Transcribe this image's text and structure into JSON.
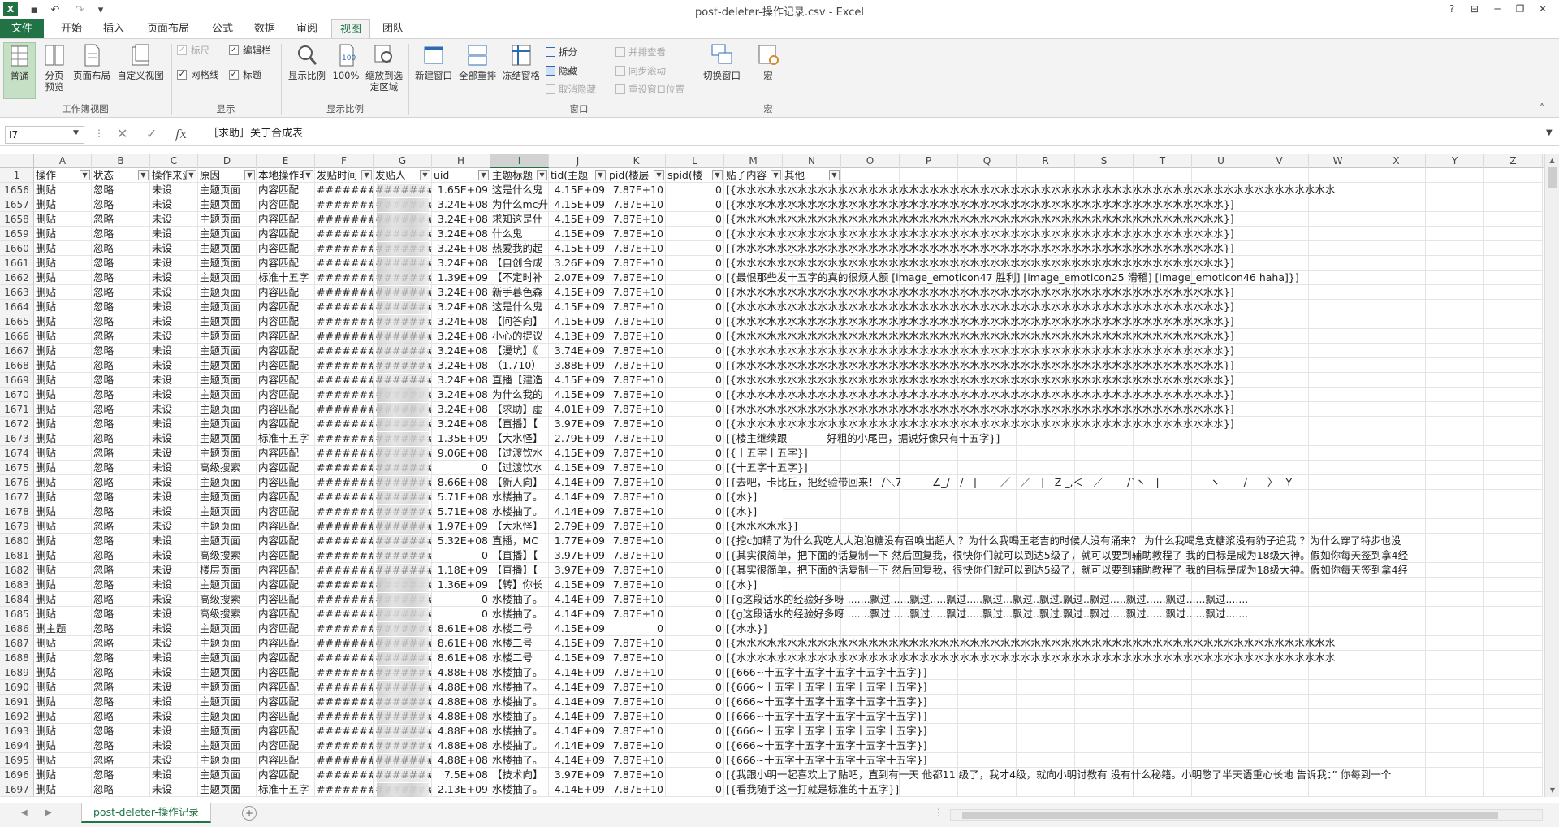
{
  "window": {
    "title": "post-deleter-操作记录.csv - Excel"
  },
  "tabs": [
    "文件",
    "开始",
    "插入",
    "页面布局",
    "公式",
    "数据",
    "审阅",
    "视图",
    "团队"
  ],
  "ribbon": {
    "workbook_views": {
      "group": "工作簿视图",
      "normal": "普通",
      "page_break": "分页预览",
      "page_layout": "页面布局",
      "custom": "自定义视图"
    },
    "show": {
      "group": "显示",
      "ruler": "标尺",
      "edit_bar": "编辑栏",
      "gridlines": "网格线",
      "headings": "标题"
    },
    "zoom": {
      "group": "显示比例",
      "zoom": "显示比例",
      "hundred": "100%",
      "to_selection": "缩放到选定区域"
    },
    "window": {
      "group": "窗口",
      "new_window": "新建窗口",
      "arrange_all": "全部重排",
      "freeze": "冻结窗格",
      "split": "拆分",
      "hide": "隐藏",
      "unhide": "取消隐藏",
      "side_by_side": "并排查看",
      "sync_scroll": "同步滚动",
      "reset_pos": "重设窗口位置",
      "switch": "切换窗口"
    },
    "macros": {
      "group": "宏",
      "macros": "宏"
    }
  },
  "formula_bar": {
    "name_box": "I7",
    "fx": "fx",
    "value": "［求助］关于合成表"
  },
  "columns": [
    "A",
    "B",
    "C",
    "D",
    "E",
    "F",
    "G",
    "H",
    "I",
    "J",
    "K",
    "L",
    "M",
    "N",
    "O",
    "P",
    "Q",
    "R",
    "S",
    "T",
    "U",
    "V",
    "W",
    "X",
    "Y",
    "Z"
  ],
  "header_row": {
    "row": "1",
    "cells": [
      "操作",
      "状态",
      "操作来源",
      "原因",
      "本地操作时",
      "发贴时间",
      "发贴人",
      "uid",
      "主题标题",
      "tid(主题",
      "pid(楼层",
      "spid(楼",
      "贴子内容",
      "其他"
    ]
  },
  "rows": [
    [
      "1656",
      "删贴",
      "忽略",
      "未设",
      "主题页面",
      "内容匹配",
      "########",
      "########",
      "1.65E+09",
      "这是什么鬼",
      "4.15E+09",
      "7.87E+10",
      "0",
      "[{水水水水水水水水水水水水水水水水水水水水水水水水水水水水水水水水水水水水水水水水水水水水水水水水水水水水水水水水水水水"
    ],
    [
      "1657",
      "删贴",
      "忽略",
      "未设",
      "主题页面",
      "内容匹配",
      "########",
      "########",
      "3.24E+08",
      "为什么mc升",
      "4.15E+09",
      "7.87E+10",
      "0",
      "[{水水水水水水水水水水水水水水水水水水水水水水水水水水水水水水水水水水水水水水水水水水水水水水水水}]"
    ],
    [
      "1658",
      "删贴",
      "忽略",
      "未设",
      "主题页面",
      "内容匹配",
      "########",
      "########",
      "3.24E+08",
      "求知这是什",
      "4.15E+09",
      "7.87E+10",
      "0",
      "[{水水水水水水水水水水水水水水水水水水水水水水水水水水水水水水水水水水水水水水水水水水水水水水水水}]"
    ],
    [
      "1659",
      "删贴",
      "忽略",
      "未设",
      "主题页面",
      "内容匹配",
      "########",
      "########",
      "3.24E+08",
      "什么鬼",
      "4.15E+09",
      "7.87E+10",
      "0",
      "[{水水水水水水水水水水水水水水水水水水水水水水水水水水水水水水水水水水水水水水水水水水水水水水水水}]"
    ],
    [
      "1660",
      "删贴",
      "忽略",
      "未设",
      "主题页面",
      "内容匹配",
      "########",
      "########",
      "3.24E+08",
      "热爱我的起",
      "4.15E+09",
      "7.87E+10",
      "0",
      "[{水水水水水水水水水水水水水水水水水水水水水水水水水水水水水水水水水水水水水水水水水水水水水水水水}]"
    ],
    [
      "1661",
      "删贴",
      "忽略",
      "未设",
      "主题页面",
      "内容匹配",
      "########",
      "########",
      "3.24E+08",
      "【自创合成",
      "3.26E+09",
      "7.87E+10",
      "0",
      "[{水水水水水水水水水水水水水水水水水水水水水水水水水水水水水水水水水水水水水水水水水水水水水水水水}]"
    ],
    [
      "1662",
      "删贴",
      "忽略",
      "未设",
      "主题页面",
      "标准十五字",
      "########",
      "########",
      "1.39E+09",
      "【不定时补",
      "2.07E+09",
      "7.87E+10",
      "0",
      "[{最恨那些发十五字的真的很烦人额 [image_emoticon47 胜利] [image_emoticon25 滑稽] [image_emoticon46 haha]}]"
    ],
    [
      "1663",
      "删贴",
      "忽略",
      "未设",
      "主题页面",
      "内容匹配",
      "########",
      "########",
      "3.24E+08",
      "新手暮色森",
      "4.15E+09",
      "7.87E+10",
      "0",
      "[{水水水水水水水水水水水水水水水水水水水水水水水水水水水水水水水水水水水水水水水水水水水水水水水水}]"
    ],
    [
      "1664",
      "删贴",
      "忽略",
      "未设",
      "主题页面",
      "内容匹配",
      "########",
      "########",
      "3.24E+08",
      "这是什么鬼",
      "4.15E+09",
      "7.87E+10",
      "0",
      "[{水水水水水水水水水水水水水水水水水水水水水水水水水水水水水水水水水水水水水水水水水水水水水水水水}]"
    ],
    [
      "1665",
      "删贴",
      "忽略",
      "未设",
      "主题页面",
      "内容匹配",
      "########",
      "########",
      "3.24E+08",
      "【问答向】",
      "4.15E+09",
      "7.87E+10",
      "0",
      "[{水水水水水水水水水水水水水水水水水水水水水水水水水水水水水水水水水水水水水水水水水水水水水水水水}]"
    ],
    [
      "1666",
      "删贴",
      "忽略",
      "未设",
      "主题页面",
      "内容匹配",
      "########",
      "########",
      "3.24E+08",
      "小心的提议",
      "4.13E+09",
      "7.87E+10",
      "0",
      "[{水水水水水水水水水水水水水水水水水水水水水水水水水水水水水水水水水水水水水水水水水水水水水水水水}]"
    ],
    [
      "1667",
      "删贴",
      "忽略",
      "未设",
      "主题页面",
      "内容匹配",
      "########",
      "########",
      "3.24E+08",
      "【漫坑】《",
      "3.74E+09",
      "7.87E+10",
      "0",
      "[{水水水水水水水水水水水水水水水水水水水水水水水水水水水水水水水水水水水水水水水水水水水水水水水水}]"
    ],
    [
      "1668",
      "删贴",
      "忽略",
      "未设",
      "主题页面",
      "内容匹配",
      "########",
      "########",
      "3.24E+08",
      "（1.710）",
      "3.88E+09",
      "7.87E+10",
      "0",
      "[{水水水水水水水水水水水水水水水水水水水水水水水水水水水水水水水水水水水水水水水水水水水水水水水水}]"
    ],
    [
      "1669",
      "删贴",
      "忽略",
      "未设",
      "主题页面",
      "内容匹配",
      "########",
      "########",
      "3.24E+08",
      "直播【建造",
      "4.15E+09",
      "7.87E+10",
      "0",
      "[{水水水水水水水水水水水水水水水水水水水水水水水水水水水水水水水水水水水水水水水水水水水水水水水水}]"
    ],
    [
      "1670",
      "删贴",
      "忽略",
      "未设",
      "主题页面",
      "内容匹配",
      "########",
      "########",
      "3.24E+08",
      "为什么我的",
      "4.15E+09",
      "7.87E+10",
      "0",
      "[{水水水水水水水水水水水水水水水水水水水水水水水水水水水水水水水水水水水水水水水水水水水水水水水水}]"
    ],
    [
      "1671",
      "删贴",
      "忽略",
      "未设",
      "主题页面",
      "内容匹配",
      "########",
      "########",
      "3.24E+08",
      "【求助】虚",
      "4.01E+09",
      "7.87E+10",
      "0",
      "[{水水水水水水水水水水水水水水水水水水水水水水水水水水水水水水水水水水水水水水水水水水水水水水水水}]"
    ],
    [
      "1672",
      "删贴",
      "忽略",
      "未设",
      "主题页面",
      "内容匹配",
      "########",
      "########",
      "3.24E+08",
      "【直播】【",
      "3.97E+09",
      "7.87E+10",
      "0",
      "[{水水水水水水水水水水水水水水水水水水水水水水水水水水水水水水水水水水水水水水水水水水水水水水水水}]"
    ],
    [
      "1673",
      "删贴",
      "忽略",
      "未设",
      "主题页面",
      "标准十五字",
      "########",
      "########",
      "1.35E+09",
      "【大水怪】",
      "2.79E+09",
      "7.87E+10",
      "0",
      "[{楼主继续跟 ----------好粗的小尾巴，据说好像只有十五字}]"
    ],
    [
      "1674",
      "删贴",
      "忽略",
      "未设",
      "主题页面",
      "内容匹配",
      "########",
      "########",
      "9.06E+08",
      "【过渡饮水",
      "4.15E+09",
      "7.87E+10",
      "0",
      "[{十五字十五字}]"
    ],
    [
      "1675",
      "删贴",
      "忽略",
      "未设",
      "高级搜索",
      "内容匹配",
      "########",
      "########",
      "0",
      "【过渡饮水",
      "4.15E+09",
      "7.87E+10",
      "0",
      "[{十五字十五字}]"
    ],
    [
      "1676",
      "删贴",
      "忽略",
      "未设",
      "主题页面",
      "内容匹配",
      "########",
      "########",
      "8.66E+08",
      "【新人向】",
      "4.14E+09",
      "7.87E+10",
      "0",
      "[{去吧，卡比丘，把经验带回来！ /＼7　　　∠_/　/　|　　 ／　／　|　Z _,＜　／　　 /`ヽ　|　　　　　ヽ　　 /　　〉　 Y"
    ],
    [
      "1677",
      "删贴",
      "忽略",
      "未设",
      "主题页面",
      "内容匹配",
      "########",
      "########",
      "5.71E+08",
      "水楼抽了。",
      "4.14E+09",
      "7.87E+10",
      "0",
      "[{水}]"
    ],
    [
      "1678",
      "删贴",
      "忽略",
      "未设",
      "主题页面",
      "内容匹配",
      "########",
      "########",
      "5.71E+08",
      "水楼抽了。",
      "4.14E+09",
      "7.87E+10",
      "0",
      "[{水}]"
    ],
    [
      "1679",
      "删贴",
      "忽略",
      "未设",
      "主题页面",
      "内容匹配",
      "########",
      "########",
      "1.97E+09",
      "【大水怪】",
      "2.79E+09",
      "7.87E+10",
      "0",
      "[{水水水水水}]"
    ],
    [
      "1680",
      "删贴",
      "忽略",
      "未设",
      "主题页面",
      "内容匹配",
      "########",
      "########",
      "5.32E+08",
      "直播，MC",
      "1.77E+09",
      "7.87E+10",
      "0",
      "[{挖c加精了为什么我吃大大泡泡糖没有召唤出超人 ？为什么我喝王老吉的时候人没有涌来？ 为什么我喝急支糖浆没有豹子追我 ？为什么穿了特步也没"
    ],
    [
      "1681",
      "删贴",
      "忽略",
      "未设",
      "高级搜索",
      "内容匹配",
      "########",
      "########",
      "0",
      "【直播】【",
      "3.97E+09",
      "7.87E+10",
      "0",
      "[{其实很简单，把下面的话复制一下 然后回复我，很快你们就可以到达5级了，就可以要到辅助教程了 我的目标是成为18级大神。假如你每天签到拿4经"
    ],
    [
      "1682",
      "删贴",
      "忽略",
      "未设",
      "楼层页面",
      "内容匹配",
      "########",
      "########",
      "1.18E+09",
      "【直播】【",
      "3.97E+09",
      "7.87E+10",
      "0",
      "[{其实很简单，把下面的话复制一下 然后回复我，很快你们就可以到达5级了，就可以要到辅助教程了 我的目标是成为18级大神。假如你每天签到拿4经"
    ],
    [
      "1683",
      "删贴",
      "忽略",
      "未设",
      "主题页面",
      "内容匹配",
      "########",
      "########",
      "1.36E+09",
      "【转】你长",
      "4.15E+09",
      "7.87E+10",
      "0",
      "[{水}]"
    ],
    [
      "1684",
      "删贴",
      "忽略",
      "未设",
      "高级搜索",
      "内容匹配",
      "########",
      "########",
      "0",
      "水楼抽了。",
      "4.14E+09",
      "7.87E+10",
      "0",
      "[{g这段话水的经验好多呀 .......飘过......飘过.....飘过.....飘过...飘过..飘过.飘过..飘过.....飘过......飘过......飘过......."
    ],
    [
      "1685",
      "删贴",
      "忽略",
      "未设",
      "高级搜索",
      "内容匹配",
      "########",
      "########",
      "0",
      "水楼抽了。",
      "4.14E+09",
      "7.87E+10",
      "0",
      "[{g这段话水的经验好多呀 .......飘过......飘过.....飘过.....飘过...飘过..飘过.飘过..飘过.....飘过......飘过......飘过......."
    ],
    [
      "1686",
      "删主题",
      "忽略",
      "未设",
      "主题页面",
      "内容匹配",
      "########",
      "########",
      "8.61E+08",
      "水楼二号",
      "4.15E+09",
      "0",
      "0",
      "[{水水}]"
    ],
    [
      "1687",
      "删贴",
      "忽略",
      "未设",
      "主题页面",
      "内容匹配",
      "########",
      "########",
      "8.61E+08",
      "水楼二号",
      "4.15E+09",
      "7.87E+10",
      "0",
      "[{水水水水水水水水水水水水水水水水水水水水水水水水水水水水水水水水水水水水水水水水水水水水水水水水水水水水水水水水水水水"
    ],
    [
      "1688",
      "删贴",
      "忽略",
      "未设",
      "主题页面",
      "内容匹配",
      "########",
      "########",
      "8.61E+08",
      "水楼二号",
      "4.15E+09",
      "7.87E+10",
      "0",
      "[{水水水水水水水水水水水水水水水水水水水水水水水水水水水水水水水水水水水水水水水水水水水水水水水水水水水水水水水水水水水"
    ],
    [
      "1689",
      "删贴",
      "忽略",
      "未设",
      "主题页面",
      "内容匹配",
      "########",
      "########",
      "4.88E+08",
      "水楼抽了。",
      "4.14E+09",
      "7.87E+10",
      "0",
      "[{666~十五字十五字十五字十五字十五字}]"
    ],
    [
      "1690",
      "删贴",
      "忽略",
      "未设",
      "主题页面",
      "内容匹配",
      "########",
      "########",
      "4.88E+08",
      "水楼抽了。",
      "4.14E+09",
      "7.87E+10",
      "0",
      "[{666~十五字十五字十五字十五字十五字}]"
    ],
    [
      "1691",
      "删贴",
      "忽略",
      "未设",
      "主题页面",
      "内容匹配",
      "########",
      "########",
      "4.88E+08",
      "水楼抽了。",
      "4.14E+09",
      "7.87E+10",
      "0",
      "[{666~十五字十五字十五字十五字十五字}]"
    ],
    [
      "1692",
      "删贴",
      "忽略",
      "未设",
      "主题页面",
      "内容匹配",
      "########",
      "########",
      "4.88E+08",
      "水楼抽了。",
      "4.14E+09",
      "7.87E+10",
      "0",
      "[{666~十五字十五字十五字十五字十五字}]"
    ],
    [
      "1693",
      "删贴",
      "忽略",
      "未设",
      "主题页面",
      "内容匹配",
      "########",
      "########",
      "4.88E+08",
      "水楼抽了。",
      "4.14E+09",
      "7.87E+10",
      "0",
      "[{666~十五字十五字十五字十五字十五字}]"
    ],
    [
      "1694",
      "删贴",
      "忽略",
      "未设",
      "主题页面",
      "内容匹配",
      "########",
      "########",
      "4.88E+08",
      "水楼抽了。",
      "4.14E+09",
      "7.87E+10",
      "0",
      "[{666~十五字十五字十五字十五字十五字}]"
    ],
    [
      "1695",
      "删贴",
      "忽略",
      "未设",
      "主题页面",
      "内容匹配",
      "########",
      "########",
      "4.88E+08",
      "水楼抽了。",
      "4.14E+09",
      "7.87E+10",
      "0",
      "[{666~十五字十五字十五字十五字十五字}]"
    ],
    [
      "1696",
      "删贴",
      "忽略",
      "未设",
      "主题页面",
      "内容匹配",
      "########",
      "########",
      "7.5E+08",
      "【技术向】",
      "3.97E+09",
      "7.87E+10",
      "0",
      "[{我跟小明一起喜欢上了贴吧，直到有一天 他都11 级了，我才4级，就向小明讨教有 没有什么秘籍。小明憋了半天语重心长地 告诉我：” 你每到一个"
    ],
    [
      "1697",
      "删贴",
      "忽略",
      "未设",
      "主题页面",
      "标准十五字",
      "########",
      "########",
      "2.13E+09",
      "水楼抽了。",
      "4.14E+09",
      "7.87E+10",
      "0",
      "[{看我随手这一打就是标准的十五字}]"
    ]
  ],
  "sheet": {
    "tab": "post-deleter-操作记录"
  },
  "colors": {
    "accent": "#217346"
  }
}
